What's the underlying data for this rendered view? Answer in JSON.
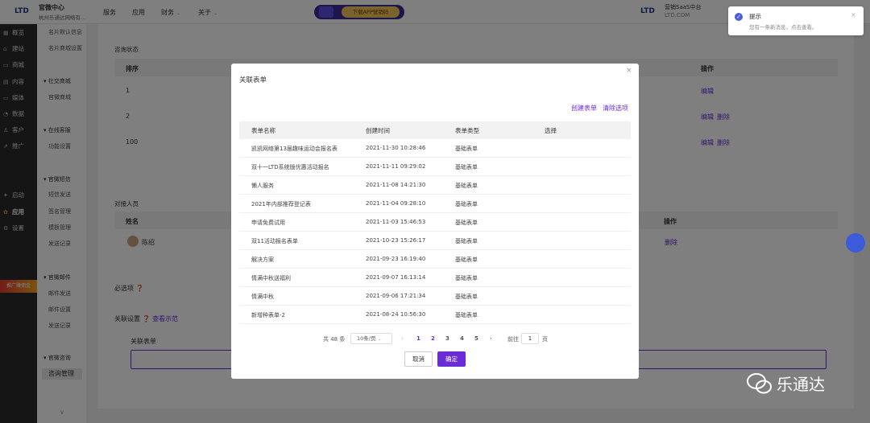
{
  "topbar": {
    "logo": "LTD",
    "app_name": "官微中心",
    "app_sub": "杭州乐通达网络有...",
    "nav": [
      {
        "label": "服务",
        "chevron": false
      },
      {
        "label": "应用",
        "chevron": false
      },
      {
        "label": "财务",
        "chevron": true
      },
      {
        "label": "关于",
        "chevron": true
      }
    ],
    "promo_label": "下载APP营销码",
    "right_logo": "LTD",
    "right_brand": "营销SaaS中台",
    "right_sub": "LTD.COM"
  },
  "toast": {
    "title": "提示",
    "message": "您有一条新消息，点击查看。",
    "close": "×"
  },
  "sidebar_primary": [
    {
      "icon": "grid",
      "label": "概览"
    },
    {
      "icon": "home",
      "label": "建站"
    },
    {
      "icon": "shop",
      "label": "商城"
    },
    {
      "icon": "doc",
      "label": "内容"
    },
    {
      "icon": "media",
      "label": "媒体"
    },
    {
      "icon": "chart",
      "label": "数据"
    },
    {
      "icon": "user",
      "label": "客户"
    },
    {
      "icon": "promo",
      "label": "推广"
    },
    {
      "icon": "launch",
      "label": "启动"
    },
    {
      "icon": "apps",
      "label": "应用"
    },
    {
      "icon": "gear",
      "label": "设置"
    }
  ],
  "sidebar_promo": "推广赚佣金",
  "sidebar_secondary": {
    "items_top": [
      "名片默认信息",
      "名片商城设置"
    ],
    "groups": [
      {
        "title": "社交商城",
        "items": [
          "官微商城"
        ]
      },
      {
        "title": "在线客服",
        "items": [
          "功能设置"
        ]
      },
      {
        "title": "官微短信",
        "items": [
          "短信发送",
          "签名管理",
          "模板管理",
          "发送记录"
        ]
      },
      {
        "title": "官微邮件",
        "items": [
          "邮件发送",
          "邮件设置",
          "发送记录"
        ]
      },
      {
        "title": "官微咨询",
        "items": [
          "咨询管理"
        ]
      }
    ],
    "collapse": "∨"
  },
  "main": {
    "section1_title": "咨询状态",
    "col_sort": "排序",
    "col_action": "操作",
    "rows": [
      {
        "sort": "1",
        "actions": [
          "编辑"
        ]
      },
      {
        "sort": "2",
        "actions": [
          "编辑",
          "删除"
        ]
      },
      {
        "sort": "100",
        "actions": [
          "编辑",
          "删除"
        ]
      }
    ],
    "section2_title": "对接人员",
    "col_name": "姓名",
    "staff": [
      {
        "name": "陈绍",
        "action": "删除"
      }
    ],
    "required_label": "必选项",
    "assoc_label": "关联设置",
    "assoc_link": "查看示范",
    "assoc_form_label": "关联表单"
  },
  "modal": {
    "title": "关联表单",
    "close": "×",
    "create_link": "创建表单",
    "clear_link": "清除选项",
    "columns": [
      "表单名称",
      "创建时间",
      "表单类型",
      "选择"
    ],
    "rows": [
      {
        "name": "凯凯网络第13届趣味运动会报名表",
        "time": "2021-11-30 10:28:46",
        "type": "基础表单"
      },
      {
        "name": "双十一LTD系统版优惠活动报名",
        "time": "2021-11-11 09:29:02",
        "type": "基础表单"
      },
      {
        "name": "懒人服务",
        "time": "2021-11-08 14:21:30",
        "type": "基础表单"
      },
      {
        "name": "2021年内部推荐登记表",
        "time": "2021-11-04 09:28:10",
        "type": "基础表单"
      },
      {
        "name": "申请免费试用",
        "time": "2021-11-03 15:46:53",
        "type": "基础表单"
      },
      {
        "name": "双11活动报名表单",
        "time": "2021-10-23 15:26:17",
        "type": "基础表单"
      },
      {
        "name": "解决方案",
        "time": "2021-09-23 16:19:40",
        "type": "基础表单"
      },
      {
        "name": "情满中秋送福利",
        "time": "2021-09-07 16:13:14",
        "type": "基础表单"
      },
      {
        "name": "情满中秋",
        "time": "2021-09-06 17:21:34",
        "type": "基础表单"
      },
      {
        "name": "新增种表单-2",
        "time": "2021-08-24 10:56:30",
        "type": "基础表单"
      }
    ],
    "pagination": {
      "total": "共 48 条",
      "page_size": "10条/页",
      "prev": "‹",
      "pages": [
        "1",
        "2",
        "3",
        "4",
        "5"
      ],
      "current": "1",
      "next": "›",
      "goto_label": "前往",
      "goto_value": "1",
      "goto_unit": "页"
    },
    "cancel": "取消",
    "confirm": "确定"
  },
  "watermark": {
    "text": "乐通达"
  },
  "colors": {
    "accent": "#6c2bd9",
    "sidebar_dark": "#2b2b2b",
    "overlay": "rgba(0,0,0,0.5)"
  }
}
